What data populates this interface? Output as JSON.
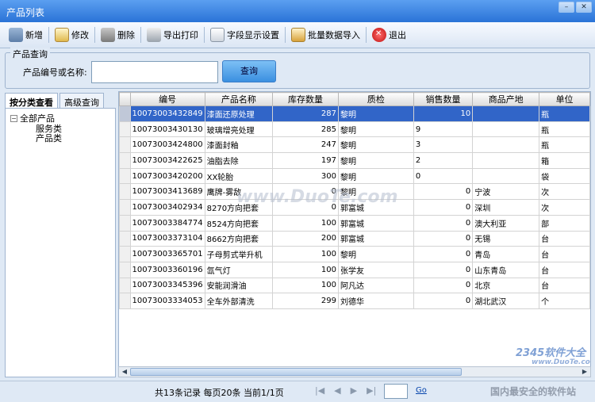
{
  "window": {
    "title": "产品列表"
  },
  "toolbar": {
    "items": [
      {
        "label": "新增",
        "icon": "add-icon"
      },
      {
        "label": "修改",
        "icon": "edit-icon"
      },
      {
        "label": "删除",
        "icon": "delete-icon"
      },
      {
        "label": "导出打印",
        "icon": "print-icon"
      },
      {
        "label": "字段显示设置",
        "icon": "field-settings-icon"
      },
      {
        "label": "批量数据导入",
        "icon": "import-icon"
      },
      {
        "label": "退出",
        "icon": "exit-icon"
      }
    ]
  },
  "query": {
    "legend": "产品查询",
    "label": "产品编号或名称:",
    "value": "",
    "button": "查询"
  },
  "left_panel": {
    "tabs": [
      "按分类查看",
      "高级查询"
    ],
    "tree": {
      "root": "全部产品",
      "children": [
        "服务类",
        "产品类"
      ]
    }
  },
  "grid": {
    "columns": [
      "编号",
      "产品名称",
      "库存数量",
      "质检",
      "销售数量",
      "商品产地",
      "单位"
    ],
    "rows": [
      [
        "10073003432849",
        "漆面还原处理",
        "287",
        "黎明",
        "10",
        "",
        "瓶"
      ],
      [
        "10073003430130",
        "玻璃增亮处理",
        "285",
        "黎明",
        "9",
        "",
        "瓶"
      ],
      [
        "10073003424800",
        "漆面封釉",
        "247",
        "黎明",
        "3",
        "",
        "瓶"
      ],
      [
        "10073003422625",
        "油脂去除",
        "197",
        "黎明",
        "2",
        "",
        "箱"
      ],
      [
        "10073003420200",
        "XX轮胎",
        "300",
        "黎明",
        "0",
        "",
        "袋"
      ],
      [
        "10073003413689",
        "鹰牌-雾敌",
        "0",
        "黎明",
        "0",
        "宁波",
        "次"
      ],
      [
        "10073003402934",
        "8270方向把套",
        "0",
        "郭富城",
        "0",
        "深圳",
        "次"
      ],
      [
        "10073003384774",
        "8524方向把套",
        "100",
        "郭富城",
        "0",
        "澳大利亚",
        "部"
      ],
      [
        "10073003373104",
        "8662方向把套",
        "200",
        "郭富城",
        "0",
        "无锡",
        "台"
      ],
      [
        "10073003365701",
        "子母剪式举升机",
        "100",
        "黎明",
        "0",
        "青岛",
        "台"
      ],
      [
        "10073003360196",
        "氙气灯",
        "100",
        "张学友",
        "0",
        "山东青岛",
        "台"
      ],
      [
        "10073003345396",
        "安能润滑油",
        "100",
        "阿凡达",
        "0",
        "北京",
        "台"
      ],
      [
        "10073003334053",
        "全车外部清洗",
        "299",
        "刘德华",
        "0",
        "湖北武汉",
        "个"
      ]
    ],
    "selected_row": 0
  },
  "pager": {
    "summary": "共13条记录  每页20条  当前1/1页",
    "page_value": "",
    "go_label": "Go"
  },
  "watermarks": {
    "center": "www.DuoTe.com",
    "brand": "2345软件大全",
    "brand_url": "www.DuoTe.com",
    "slogan": "国内最安全的软件站"
  }
}
